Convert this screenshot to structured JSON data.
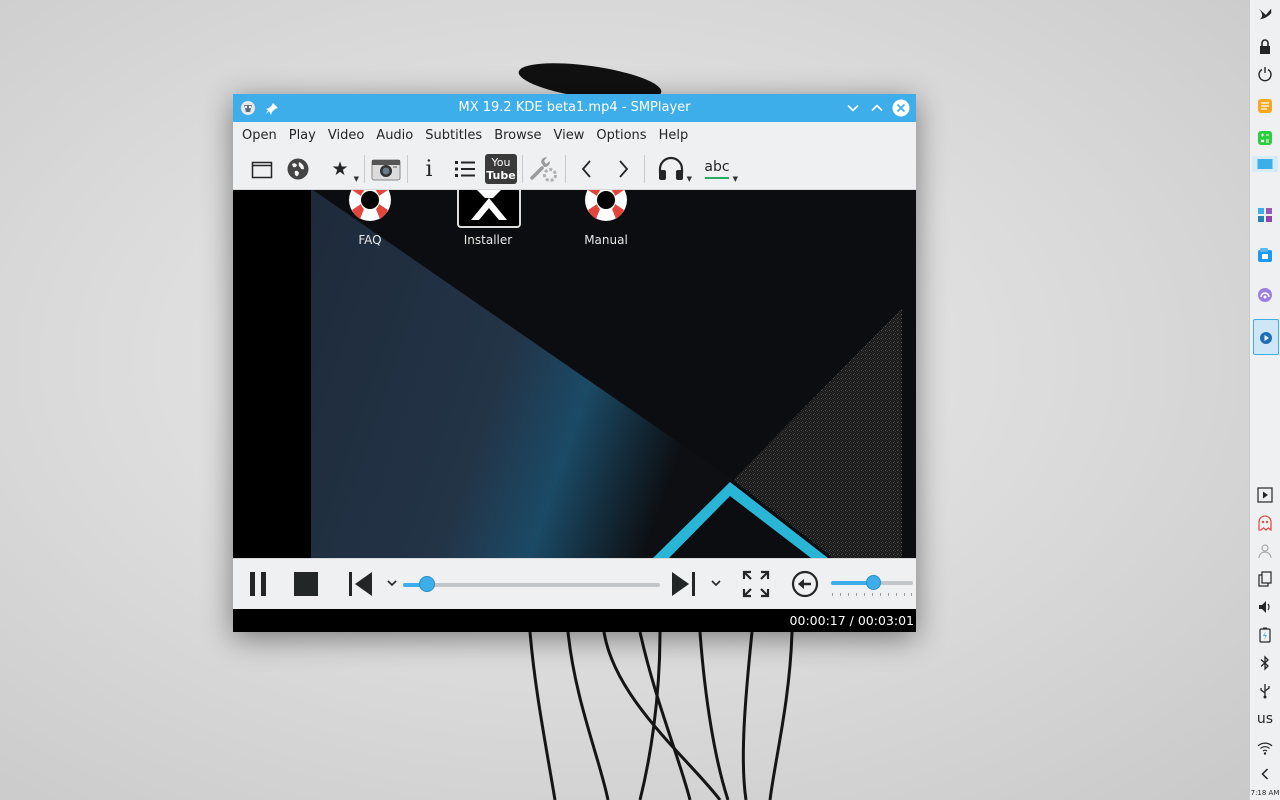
{
  "window": {
    "title": "MX 19.2 KDE beta1.mp4 - SMPlayer"
  },
  "menu": [
    "Open",
    "Play",
    "Video",
    "Audio",
    "Subtitles",
    "Browse",
    "View",
    "Options",
    "Help"
  ],
  "toolbar": {
    "icons": [
      "open-folder-icon",
      "open-url-icon",
      "favorites-icon",
      "screenshot-icon",
      "info-icon",
      "playlist-icon",
      "youtube-icon",
      "preferences-icon",
      "previous-icon",
      "next-icon",
      "audio-track-icon",
      "subtitle-track-icon"
    ],
    "youtube_label_1": "You",
    "youtube_label_2": "Tube",
    "subtitle_label": "abc"
  },
  "video": {
    "labels": [
      "FAQ",
      "Installer",
      "Manual"
    ]
  },
  "playback": {
    "state": "playing",
    "position": "00:00:17",
    "duration": "00:03:01",
    "time_display": "00:00:17 / 00:03:01",
    "progress_fraction": 0.094,
    "volume_fraction": 0.51
  },
  "panel": {
    "keyboard_layout": "us",
    "clock": "7:18 AM"
  },
  "colors": {
    "accent": "#3daee9",
    "titlebar": "#3daee9",
    "window_bg": "#eff0f1"
  }
}
